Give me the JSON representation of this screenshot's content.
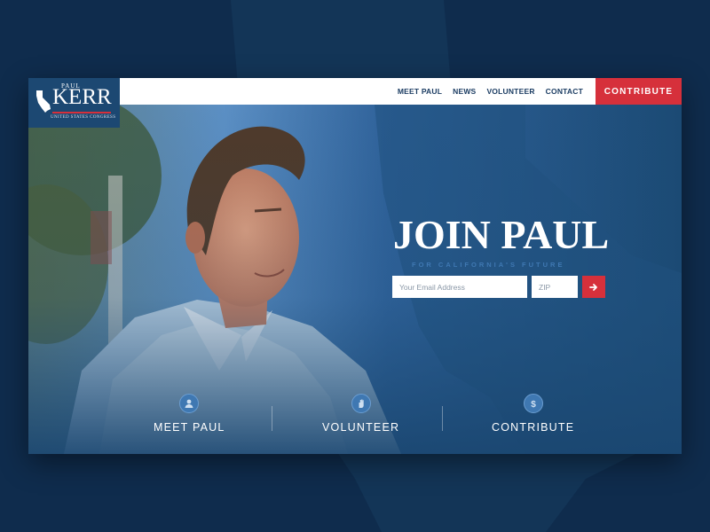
{
  "logo": {
    "first_name": "PAUL",
    "last_name": "KERR",
    "subtitle": "UNITED STATES CONGRESS"
  },
  "nav": {
    "items": [
      {
        "label": "MEET PAUL"
      },
      {
        "label": "NEWS"
      },
      {
        "label": "VOLUNTEER"
      },
      {
        "label": "CONTACT"
      }
    ],
    "contribute_label": "CONTRIBUTE"
  },
  "hero": {
    "title": "JOIN PAUL",
    "subtitle": "FOR CALIFORNIA'S FUTURE"
  },
  "signup": {
    "email_placeholder": "Your Email Address",
    "zip_placeholder": "ZIP",
    "submit_icon": "arrow-right-icon"
  },
  "cta": [
    {
      "label": "MEET PAUL",
      "icon": "person-icon"
    },
    {
      "label": "VOLUNTEER",
      "icon": "hand-icon"
    },
    {
      "label": "CONTRIBUTE",
      "icon": "dollar-icon"
    }
  ],
  "colors": {
    "page_bg": "#0f2c4d",
    "brand_navy": "#1c4872",
    "accent_red": "#d6303b",
    "accent_blue": "#3f78b2"
  }
}
